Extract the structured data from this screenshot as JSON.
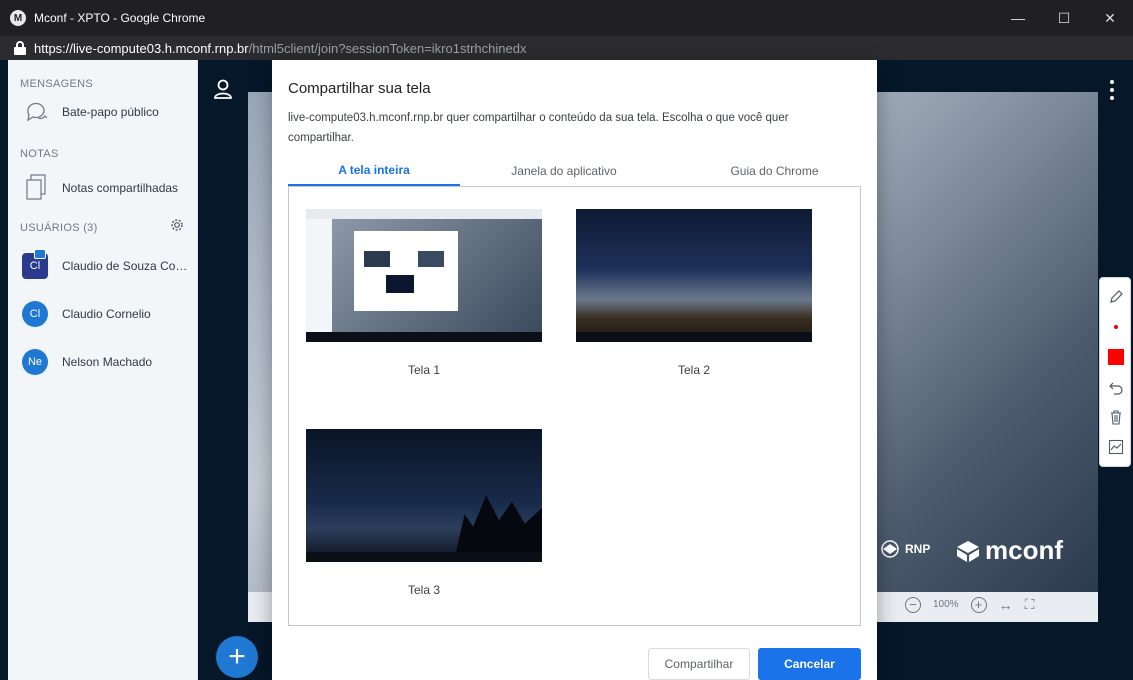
{
  "window": {
    "title": "Mconf - XPTO - Google Chrome",
    "url_host": "https://live-compute03.h.mconf.rnp.br",
    "url_path": "/html5client/join?sessionToken=ikro1strhchinedx",
    "controls": {
      "minimize": "—",
      "maximize": "☐",
      "close": "✕"
    }
  },
  "sidebar": {
    "messages_title": "MENSAGENS",
    "public_chat": "Bate-papo público",
    "notes_title": "NOTAS",
    "shared_notes": "Notas compartilhadas",
    "users_title": "USUÁRIOS (3)",
    "users": [
      {
        "initials": "Cl",
        "name": "Claudio de Souza Cor..."
      },
      {
        "initials": "Cl",
        "name": "Claudio Cornelio"
      },
      {
        "initials": "Ne",
        "name": "Nelson Machado"
      }
    ]
  },
  "presentation": {
    "logo_rnp": "RNP",
    "logo_mconf": "mconf",
    "zoom_level": "100%",
    "zoom_out": "−",
    "zoom_in": "+",
    "fit_width": "↔",
    "fullscreen": "⛶"
  },
  "whiteboard_tools": [
    "pencil-icon",
    "dot-icon",
    "color-icon",
    "undo-icon",
    "trash-icon",
    "chart-icon"
  ],
  "fab": {
    "label": "+"
  },
  "dialog": {
    "title": "Compartilhar sua tela",
    "description": "live-compute03.h.mconf.rnp.br quer compartilhar o conteúdo da sua tela. Escolha o que você quer compartilhar.",
    "tabs": [
      "A tela inteira",
      "Janela do aplicativo",
      "Guia do Chrome"
    ],
    "active_tab": 0,
    "screens": [
      {
        "label": "Tela 1"
      },
      {
        "label": "Tela 2"
      },
      {
        "label": "Tela 3"
      }
    ],
    "share_button": "Compartilhar",
    "cancel_button": "Cancelar"
  }
}
